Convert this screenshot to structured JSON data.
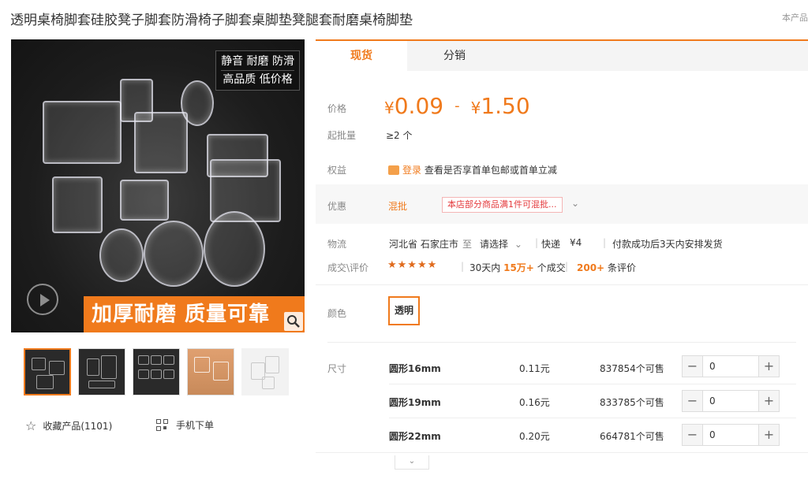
{
  "title": "透明桌椅脚套硅胶凳子脚套防滑椅子脚套桌脚垫凳腿套耐磨桌椅脚垫",
  "corner_text": "本产品",
  "image": {
    "badge_line1": "静音 耐磨 防滑",
    "badge_line2": "高品质 低价格",
    "banner": "加厚耐磨  质量可靠"
  },
  "gallery": {
    "favorite_label": "收藏产品(1101)",
    "mobile_label": "手机下单"
  },
  "tabs": [
    "现货",
    "分销"
  ],
  "price": {
    "label": "价格",
    "currency": "¥",
    "low": "0.09",
    "high": "1.50",
    "dash": "-"
  },
  "moq": {
    "label": "起批量",
    "value": "≥2 个"
  },
  "rights": {
    "label": "权益",
    "login_link": "登录",
    "text": "查看是否享首单包邮或首单立减"
  },
  "promo": {
    "label": "优惠",
    "type": "混批",
    "tag": "本店部分商品满1件可混批...",
    "arrow": "⌄"
  },
  "logistics": {
    "label": "物流",
    "from": "河北省 石家庄市",
    "to_word": "至",
    "select": "请选择",
    "express_label": "快递",
    "express_fee": "¥4",
    "ship_note": "付款成功后3天内安排发货"
  },
  "reviews": {
    "label": "成交\\评价",
    "rating": 4.5,
    "stars": "★★★★★",
    "days_text": "30天内",
    "deals": "15万+",
    "deals_unit": "个成交",
    "review_count": "200+",
    "review_unit": "条评价"
  },
  "color": {
    "label": "颜色",
    "option": "透明"
  },
  "size": {
    "label": "尺寸",
    "rows": [
      {
        "name": "圆形16mm",
        "price": "0.11元",
        "stock": "837854个可售",
        "qty": "0"
      },
      {
        "name": "圆形19mm",
        "price": "0.16元",
        "stock": "833785个可售",
        "qty": "0"
      },
      {
        "name": "圆形22mm",
        "price": "0.20元",
        "stock": "664781个可售",
        "qty": "0"
      }
    ],
    "expand": "⌄"
  },
  "colors": {
    "accent": "#f07a1c",
    "promo_red": "#e4393c"
  }
}
